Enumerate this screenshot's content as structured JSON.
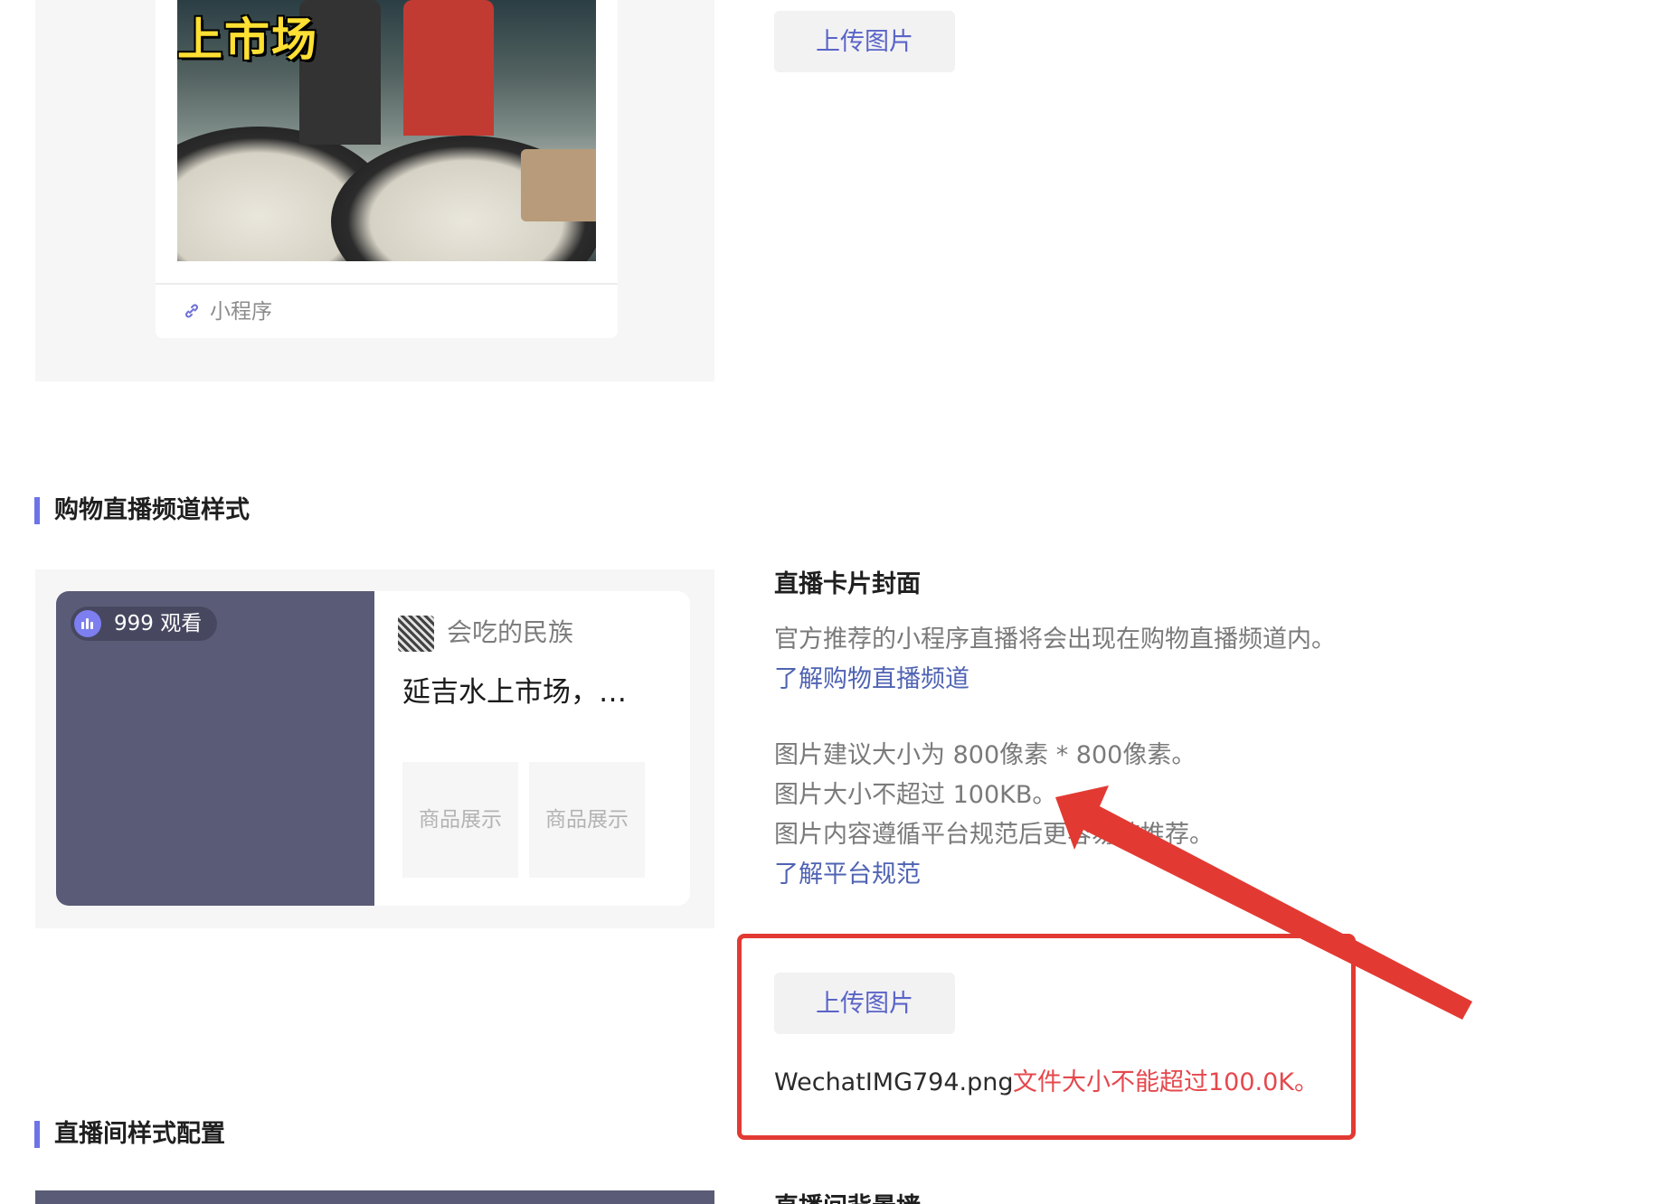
{
  "top_preview": {
    "thumbnail_overlay_text": "上市场",
    "miniprogram_label": "小程序",
    "upload_label": "上传图片"
  },
  "channel_section": {
    "title": "购物直播频道样式",
    "preview": {
      "viewer_count": "999 观看",
      "author_name": "会吃的民族",
      "room_title": "延吉水上市场，…",
      "product_tiles": [
        "商品展示",
        "商品展示"
      ]
    },
    "cover": {
      "label": "直播卡片封面",
      "description": "官方推荐的小程序直播将会出现在购物直播频道内。",
      "learn_channel_link": "了解购物直播频道",
      "size_hint": "图片建议大小为 800像素 * 800像素。",
      "file_limit": "图片大小不超过 100KB。",
      "content_rule": "图片内容遵循平台规范后更容易被推荐。",
      "learn_rules_link": "了解平台规范",
      "upload_label": "上传图片",
      "uploaded_filename": "WechatIMG794.png",
      "error_message": "文件大小不能超过100.0K。"
    }
  },
  "room_section": {
    "title": "直播间样式配置",
    "background_label": "直播间背景墙"
  },
  "colors": {
    "accent": "#6c74e6",
    "link": "#4f63b3",
    "error": "#e5484d",
    "annotation": "#e23a33",
    "cover_placeholder": "#5a5b76"
  }
}
